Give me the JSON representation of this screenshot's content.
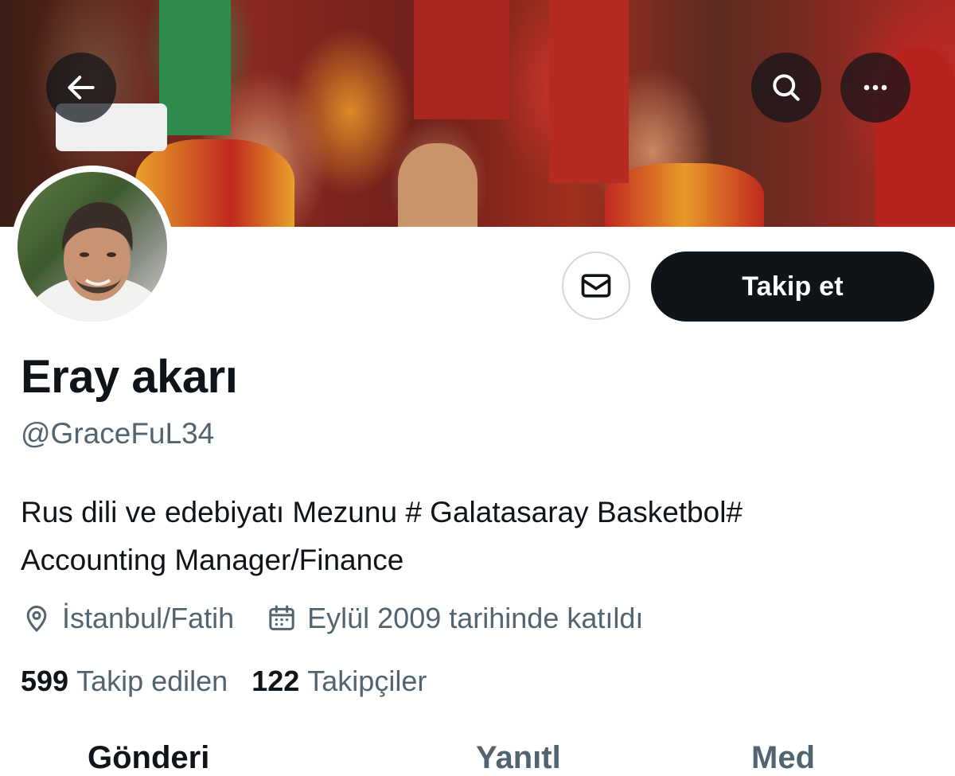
{
  "header": {
    "back_icon": "arrow-left-icon",
    "search_icon": "search-icon",
    "more_icon": "more-horizontal-icon"
  },
  "profile": {
    "display_name": "Eray akarı",
    "handle": "@GraceFuL34",
    "bio_line1": "Rus dili ve edebiyatı Mezunu # Galatasaray Basketbol#",
    "bio_line2": "Accounting Manager/Finance",
    "location": "İstanbul/Fatih",
    "joined": "Eylül 2009 tarihinde katıldı",
    "following_count": "599",
    "following_label": "Takip edilen",
    "followers_count": "122",
    "followers_label": "Takipçiler"
  },
  "actions": {
    "message_icon": "envelope-icon",
    "follow_label": "Takip et"
  },
  "tabs": [
    {
      "label": "Gönderi"
    },
    {
      "label": "Yanıtl"
    },
    {
      "label": "Med"
    }
  ],
  "colors": {
    "text": "#0f1419",
    "secondary": "#536471",
    "button": "#0f1419",
    "border": "#cfd9de"
  }
}
